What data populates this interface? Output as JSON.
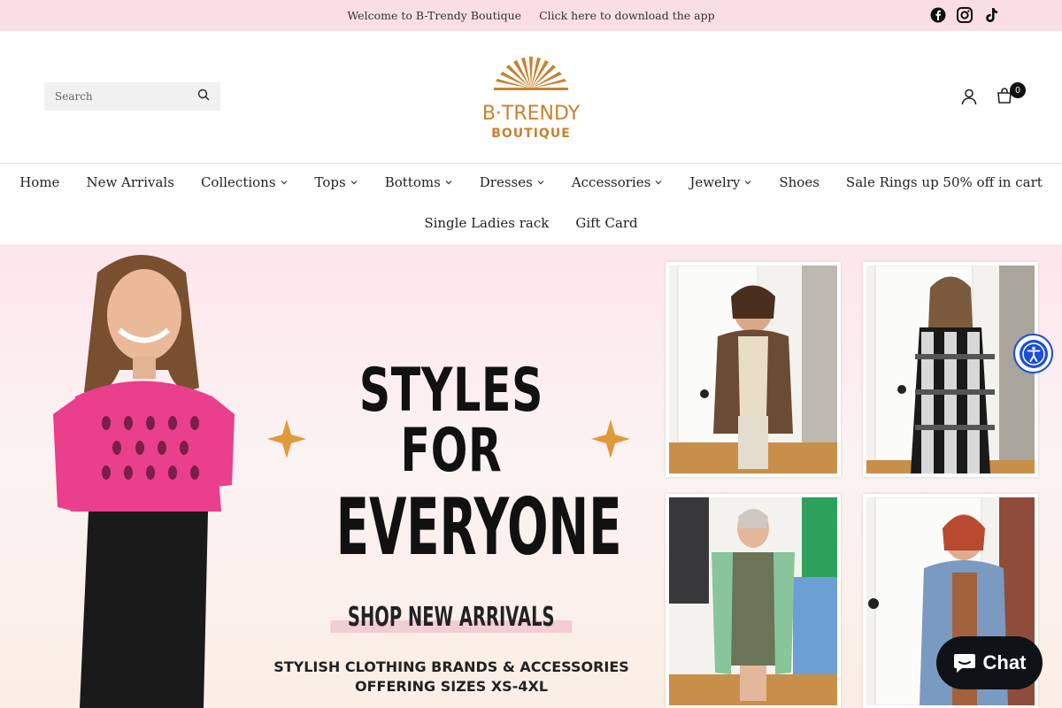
{
  "announcement": {
    "welcome": "Welcome to B-Trendy Boutique",
    "download": "Click here to download the app"
  },
  "socials": [
    "facebook-icon",
    "instagram-icon",
    "tiktok-icon"
  ],
  "header": {
    "search_placeholder": "Search",
    "logo_line1": "B·TRENDY",
    "logo_line2": "BOUTIQUE",
    "cart_count": "0",
    "brand_color": "#c8812f"
  },
  "nav": {
    "row1": [
      {
        "label": "Home",
        "dropdown": false
      },
      {
        "label": "New Arrivals",
        "dropdown": false
      },
      {
        "label": "Collections",
        "dropdown": true
      },
      {
        "label": "Tops",
        "dropdown": true
      },
      {
        "label": "Bottoms",
        "dropdown": true
      },
      {
        "label": "Dresses",
        "dropdown": true
      },
      {
        "label": "Accessories",
        "dropdown": true
      },
      {
        "label": "Jewelry",
        "dropdown": true
      },
      {
        "label": "Shoes",
        "dropdown": false
      },
      {
        "label": "Sale Rings up 50% off in cart",
        "dropdown": false
      }
    ],
    "row2": [
      {
        "label": "Single Ladies rack",
        "dropdown": false
      },
      {
        "label": "Gift Card",
        "dropdown": false
      }
    ]
  },
  "hero": {
    "headline1": "STYLES FOR",
    "headline2": "EVERYONE",
    "cta": "SHOP NEW ARRIVALS",
    "subline1": "STYLISH CLOTHING BRANDS  & ACCESSORIES",
    "subline2": "OFFERING SIZES XS-4XL",
    "accent_color": "#e09a3c",
    "highlight_color": "#f1cdd4"
  },
  "widgets": {
    "chat_label": "Chat"
  }
}
